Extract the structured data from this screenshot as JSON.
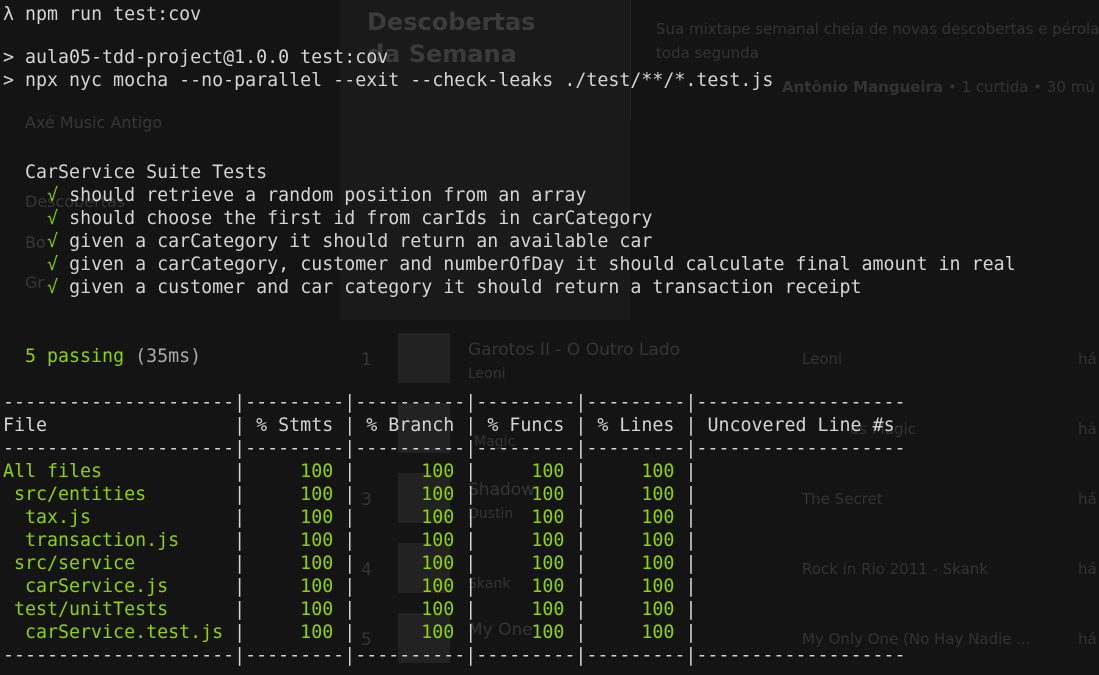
{
  "terminal": {
    "prompt_symbol": "λ",
    "command": "npm run test:cov",
    "script_line_1": "> aula05-tdd-project@1.0.0 test:cov",
    "script_line_2": "> npx nyc mocha --no-parallel --exit --check-leaks ./test/**/*.test.js",
    "suite_title": "CarService Suite Tests",
    "check_mark": "√",
    "tests": [
      "should retrieve a random position from an array",
      "should choose the first id from carIds in carCategory",
      "given a carCategory it should return an available car",
      "given a carCategory, customer and numberOfDay it should calculate final amount in real",
      "given a customer and car category it should return a transaction receipt"
    ],
    "passing": "5 passing",
    "duration": "(35ms)"
  },
  "coverage": {
    "separator": "---------------------|---------|----------|---------|---------|-------------------",
    "headers": [
      "File",
      "% Stmts",
      "% Branch",
      "% Funcs",
      "% Lines",
      "Uncovered Line #s"
    ],
    "rows": [
      {
        "file": "All files",
        "stmts": "100",
        "branch": "100",
        "funcs": "100",
        "lines": "100",
        "uncovered": ""
      },
      {
        "file": " src/entities",
        "stmts": "100",
        "branch": "100",
        "funcs": "100",
        "lines": "100",
        "uncovered": ""
      },
      {
        "file": "  tax.js",
        "stmts": "100",
        "branch": "100",
        "funcs": "100",
        "lines": "100",
        "uncovered": ""
      },
      {
        "file": "  transaction.js",
        "stmts": "100",
        "branch": "100",
        "funcs": "100",
        "lines": "100",
        "uncovered": ""
      },
      {
        "file": " src/service",
        "stmts": "100",
        "branch": "100",
        "funcs": "100",
        "lines": "100",
        "uncovered": ""
      },
      {
        "file": "  carService.js",
        "stmts": "100",
        "branch": "100",
        "funcs": "100",
        "lines": "100",
        "uncovered": ""
      },
      {
        "file": " test/unitTests",
        "stmts": "100",
        "branch": "100",
        "funcs": "100",
        "lines": "100",
        "uncovered": ""
      },
      {
        "file": "  carService.test.js",
        "stmts": "100",
        "branch": "100",
        "funcs": "100",
        "lines": "100",
        "uncovered": ""
      }
    ]
  },
  "background_app": {
    "heading_line_1": "Descobertas",
    "heading_line_2": "da Semana",
    "description_line_1": "Sua mixtape semanal cheia de novas descobertas e pérola",
    "description_line_2": "toda segunda",
    "credit_bold": "Antônio Mangueira",
    "credit_rest": "• 1 curtida • 30 mú",
    "sidebar_items": [
      "Axé Music Antigo",
      "Descobertas",
      "Bo",
      "Gr"
    ],
    "track_numbers": [
      "1",
      "3",
      "4",
      "5"
    ],
    "track_titles": [
      "Garotos II - O Outro Lado",
      "Shadow",
      "My One"
    ],
    "track_artists": [
      "Leoni",
      "Magic",
      "Dustin",
      "Skank"
    ],
    "albums": [
      "Leoni",
      "es Magic",
      "The Secret",
      "Rock in Rio 2011 - Skank",
      "My Only One (No Hay Nadie ..."
    ],
    "added_label": "há"
  },
  "colors": {
    "background": "#141414",
    "text": "#d4d4d4",
    "success_green": "#8fd400",
    "duration_gray": "#a9a9a9"
  }
}
